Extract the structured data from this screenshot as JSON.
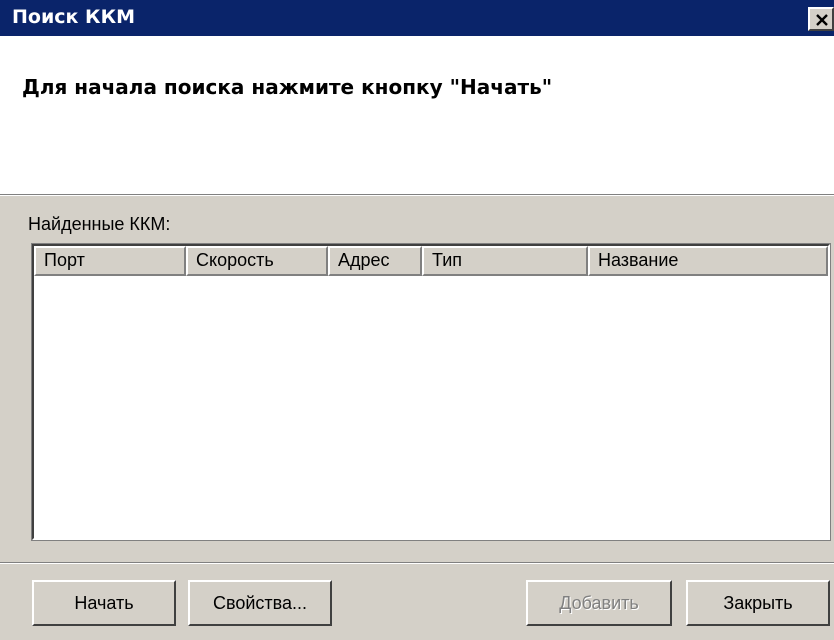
{
  "window": {
    "title": "Поиск ККМ",
    "close_icon": "close-icon"
  },
  "header": {
    "instruction": "Для начала поиска нажмите кнопку \"Начать\""
  },
  "found": {
    "label": "Найденные ККМ:",
    "columns": [
      "Порт",
      "Скорость",
      "Адрес",
      "Тип",
      "Название"
    ],
    "rows": []
  },
  "buttons": {
    "start": "Начать",
    "properties": "Свойства...",
    "add": "Добавить",
    "close": "Закрыть"
  },
  "colors": {
    "titlebar": "#0a246a",
    "face": "#d4d0c8",
    "disabled_text": "#808080"
  }
}
